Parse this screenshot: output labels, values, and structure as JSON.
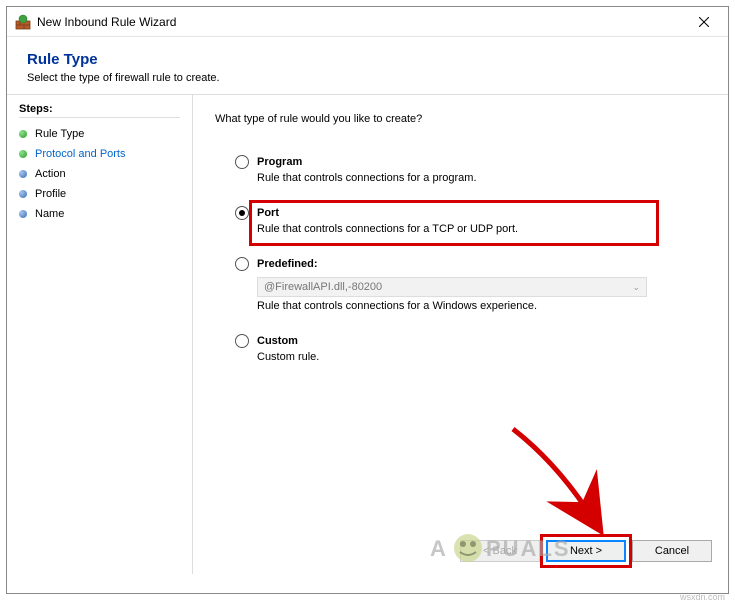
{
  "window": {
    "title": "New Inbound Rule Wizard"
  },
  "header": {
    "title": "Rule Type",
    "subtitle": "Select the type of firewall rule to create."
  },
  "sidebar": {
    "title": "Steps:",
    "items": [
      {
        "label": "Rule Type",
        "state": "done"
      },
      {
        "label": "Protocol and Ports",
        "state": "current"
      },
      {
        "label": "Action",
        "state": "todo"
      },
      {
        "label": "Profile",
        "state": "todo"
      },
      {
        "label": "Name",
        "state": "todo"
      }
    ]
  },
  "main": {
    "prompt": "What type of rule would you like to create?",
    "options": {
      "program": {
        "label": "Program",
        "desc": "Rule that controls connections for a program."
      },
      "port": {
        "label": "Port",
        "desc": "Rule that controls connections for a TCP or UDP port."
      },
      "predefined": {
        "label": "Predefined:",
        "dropdown": "@FirewallAPI.dll,-80200",
        "desc": "Rule that controls connections for a Windows experience."
      },
      "custom": {
        "label": "Custom",
        "desc": "Custom rule."
      }
    },
    "selected": "port"
  },
  "footer": {
    "back": "< Back",
    "next": "Next >",
    "cancel": "Cancel"
  },
  "watermark": "wsxdn.com",
  "logo_text": "A  PUALS"
}
